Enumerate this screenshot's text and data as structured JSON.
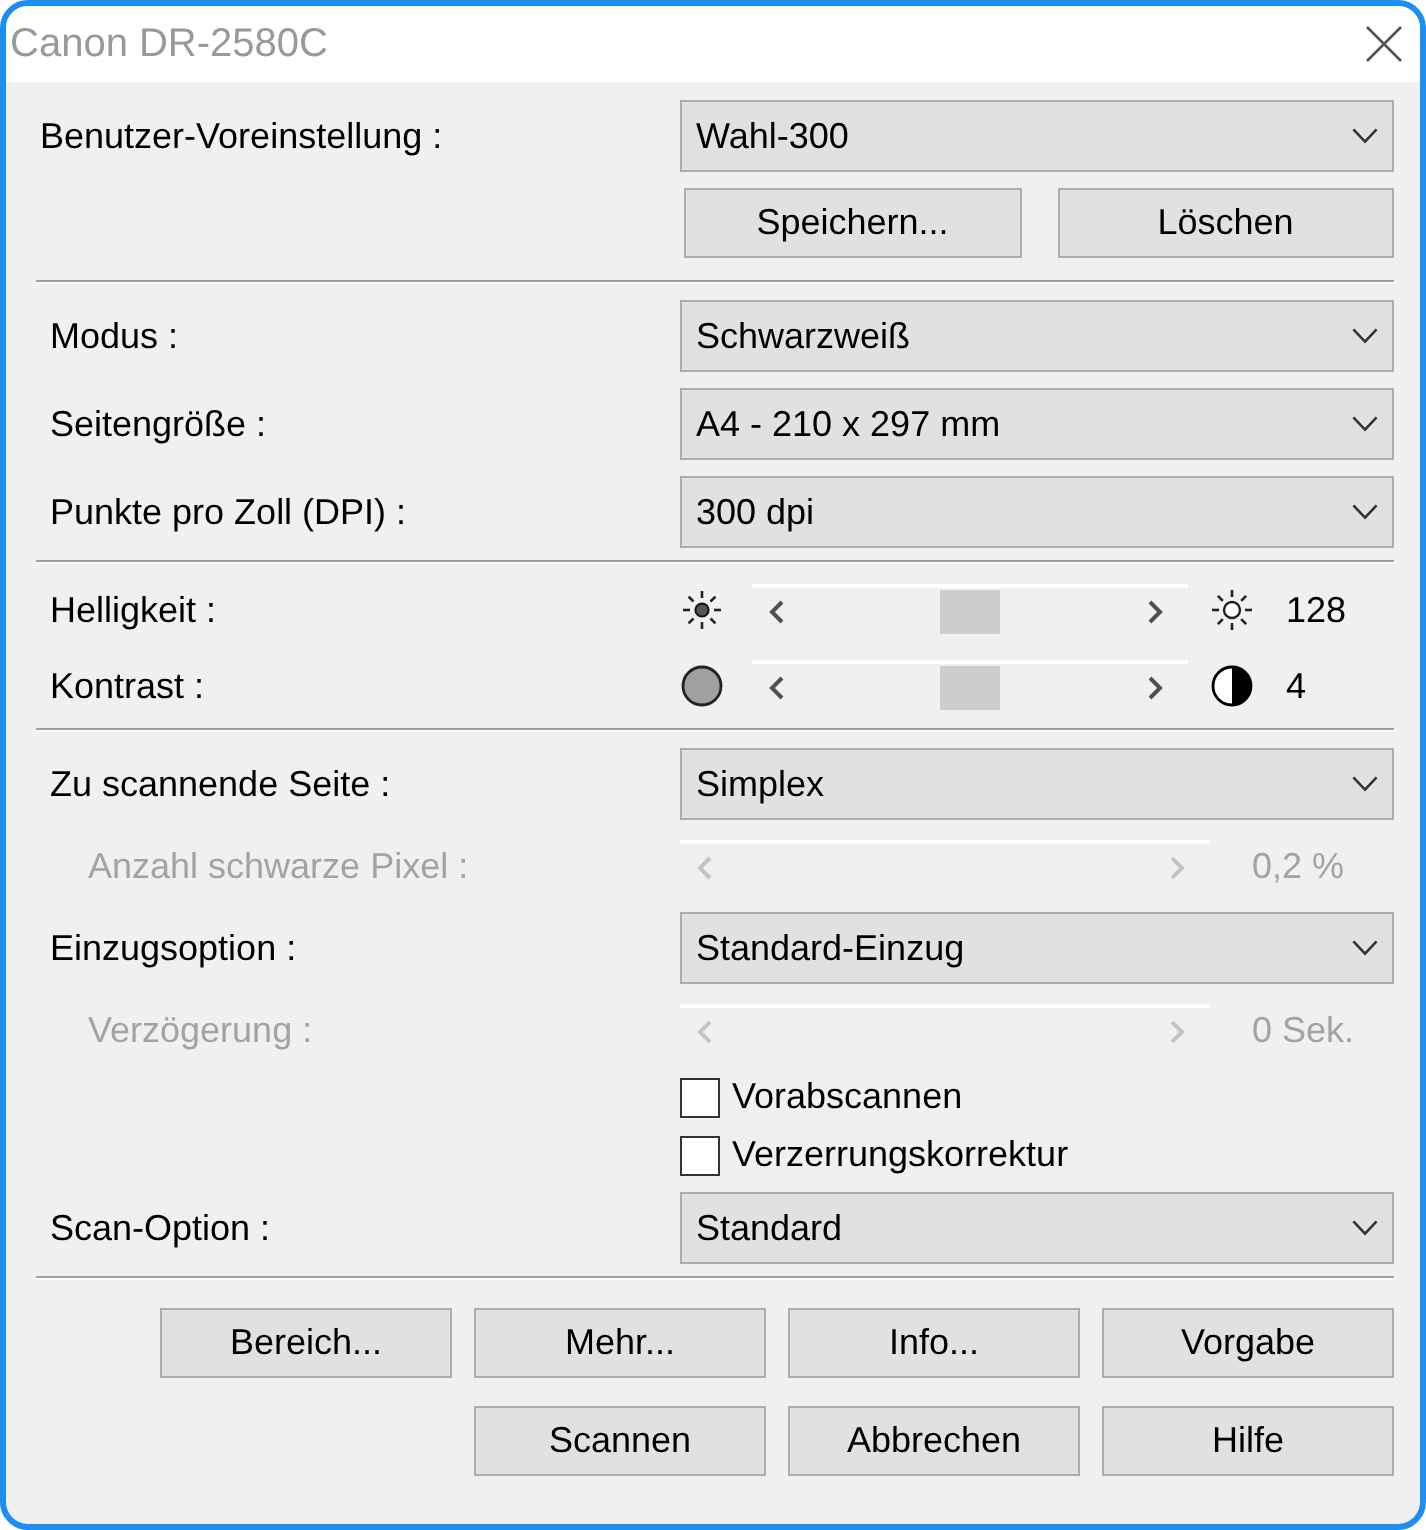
{
  "window": {
    "title": "Canon DR-2580C"
  },
  "preset": {
    "label": "Benutzer-Voreinstellung :",
    "value": "Wahl-300",
    "buttons": [
      "Speichern...",
      "Löschen"
    ]
  },
  "groups": [
    {
      "rows": [
        {
          "kind": "dropdown",
          "label": "Modus :",
          "value": "Schwarzweiß",
          "disabled": false
        },
        {
          "kind": "dropdown",
          "label": "Seitengröße :",
          "value": "A4 - 210 x 297 mm",
          "disabled": false
        },
        {
          "kind": "dropdown",
          "label": "Punkte pro Zoll (DPI) :",
          "value": "300 dpi",
          "disabled": false
        }
      ]
    },
    {
      "rows": [
        {
          "kind": "brightness",
          "label": "Helligkeit :",
          "level": 0.5,
          "reading": "128",
          "disabled": false
        },
        {
          "kind": "contrast",
          "label": "Kontrast :",
          "level": 0.5,
          "reading": "4",
          "disabled": false
        }
      ]
    },
    {
      "rows": [
        {
          "kind": "dropdown",
          "label": "Zu scannende Seite :",
          "value": "Simplex",
          "disabled": false,
          "children": [
            {
              "kind": "slider",
              "label": "Anzahl schwarze Pixel :",
              "reading": "0,2 %",
              "disabled": true
            }
          ]
        },
        {
          "kind": "dropdown",
          "label": "Einzugsoption :",
          "value": "Standard-Einzug",
          "disabled": false,
          "children": [
            {
              "kind": "slider",
              "label": "Verzögerung :",
              "reading": "0 Sek.",
              "disabled": true
            }
          ]
        },
        {
          "kind": "checkbox",
          "label": "Vorabscannen",
          "checked": false,
          "disabled": false
        },
        {
          "kind": "checkbox",
          "label": "Verzerrungskorrektur",
          "checked": false,
          "disabled": false
        },
        {
          "kind": "dropdown",
          "label": "Scan-Option :",
          "value": "Standard",
          "disabled": false
        }
      ]
    }
  ],
  "button_rows": [
    [
      "Bereich...",
      "Mehr...",
      "Info...",
      "Vorgabe"
    ],
    [
      "Scannen",
      "Abbrechen",
      "Hilfe"
    ]
  ]
}
